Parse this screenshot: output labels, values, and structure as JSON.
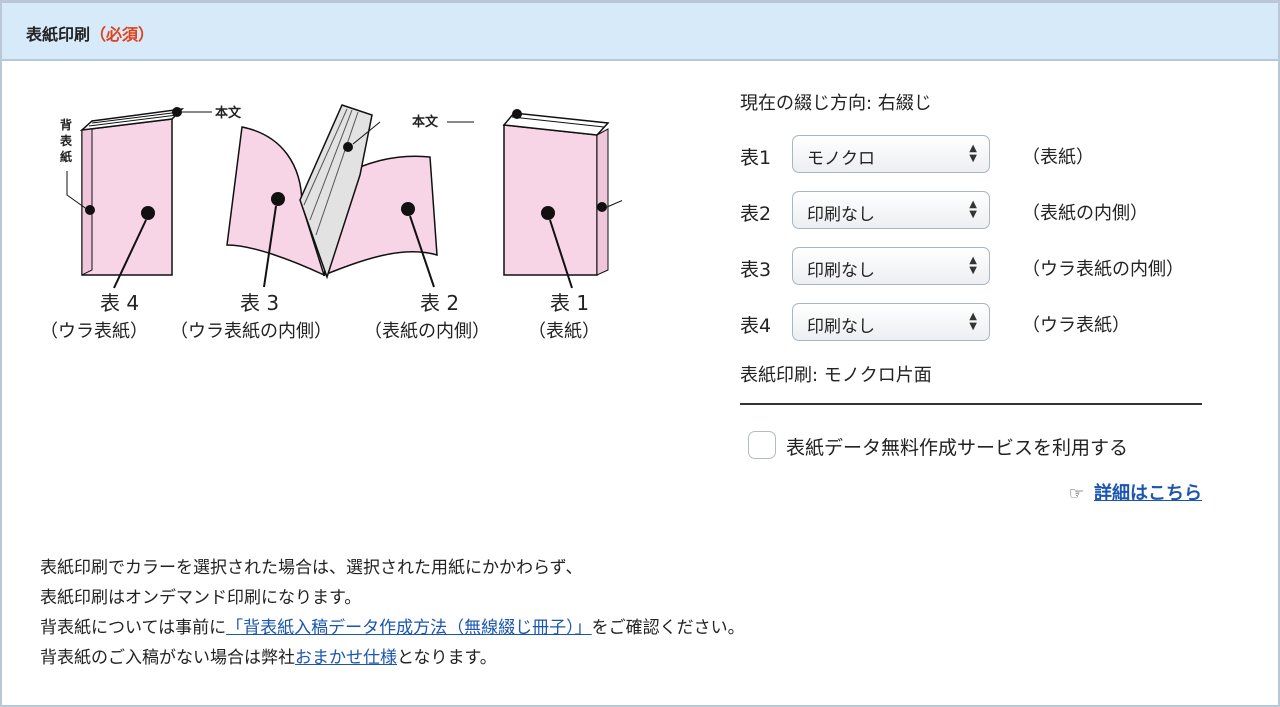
{
  "header": {
    "title": "表紙印刷",
    "required": "（必須）"
  },
  "illustration": {
    "honbun": "本文",
    "sebyoshi": [
      "背",
      "表",
      "紙"
    ],
    "books": [
      {
        "num": "表 4",
        "desc": "（ウラ表紙）"
      },
      {
        "num": "表 3",
        "desc": "（ウラ表紙の内側）"
      },
      {
        "num": "表 2",
        "desc": "（表紙の内側）"
      },
      {
        "num": "表 1",
        "desc": "（表紙）"
      }
    ],
    "colors": {
      "pink": "#f7d5e6",
      "page_gray": "#e2e2e2",
      "ink": "#111111"
    }
  },
  "options": {
    "binding_direction": "現在の綴じ方向: 右綴じ",
    "rows": [
      {
        "label": "表1",
        "value": "モノクロ",
        "note": "（表紙）"
      },
      {
        "label": "表2",
        "value": "印刷なし",
        "note": "（表紙の内側）"
      },
      {
        "label": "表3",
        "value": "印刷なし",
        "note": "（ウラ表紙の内側）"
      },
      {
        "label": "表4",
        "value": "印刷なし",
        "note": "（ウラ表紙）"
      }
    ],
    "summary": "表紙印刷: モノクロ片面",
    "checkbox_label": "表紙データ無料作成サービスを利用する",
    "detail_link": "詳細はこちら"
  },
  "notes": {
    "line1": "表紙印刷でカラーを選択された場合は、選択された用紙にかかわらず、",
    "line2": "表紙印刷はオンデマンド印刷になります。",
    "line3_pre": "背表紙については事前に",
    "line3_link": "「背表紙入稿データ作成方法（無線綴じ冊子）」",
    "line3_post": "をご確認ください。",
    "line4_pre": "背表紙のご入稿がない場合は弊社",
    "line4_link": "おまかせ仕様",
    "line4_post": "となります。"
  },
  "colors": {
    "header_bg": "#d6eafa",
    "border": "#b9c7d6",
    "required": "#e0421a",
    "link": "#1a55b0"
  }
}
